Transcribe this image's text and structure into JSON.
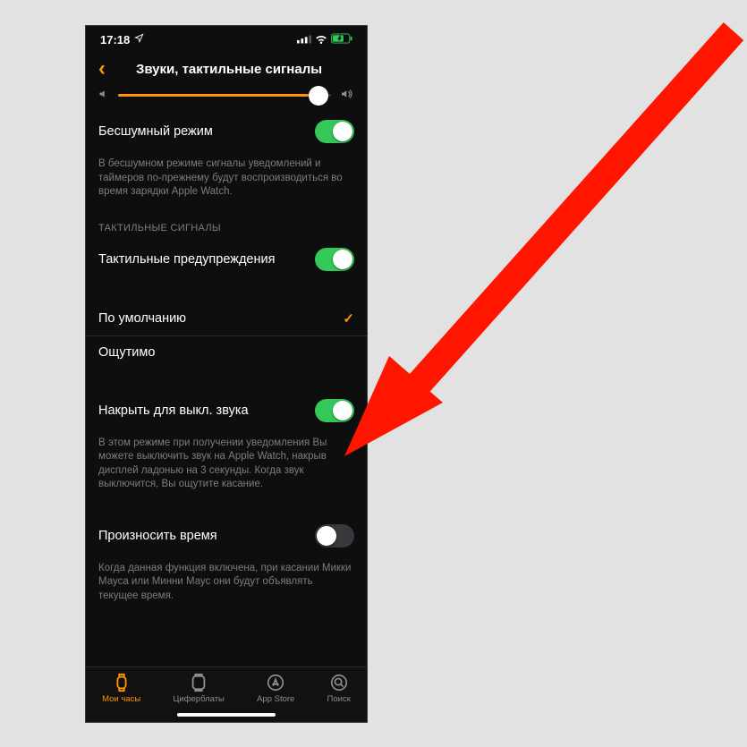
{
  "statusbar": {
    "time": "17:18"
  },
  "nav": {
    "title": "Звуки, тактильные сигналы"
  },
  "silent": {
    "label": "Бесшумный режим",
    "on": true,
    "footer": "В бесшумном режиме сигналы уведомлений и таймеров по-прежнему будут воспроизводиться во время зарядки Apple Watch."
  },
  "haptic": {
    "header": "ТАКТИЛЬНЫЕ СИГНАЛЫ",
    "alerts_label": "Тактильные предупреждения",
    "alerts_on": true,
    "options": {
      "default": "По умолчанию",
      "prominent": "Ощутимо"
    }
  },
  "cover": {
    "label": "Накрыть для выкл. звука",
    "on": true,
    "footer": "В этом режиме при получении уведомления Вы можете выключить звук на Apple Watch, накрыв дисплей ладонью на 3 секунды. Когда звук выключится, Вы ощутите касание."
  },
  "speak_time": {
    "label": "Произносить время",
    "on": false,
    "footer": "Когда данная функция включена, при касании Микки Мауса или Минни Маус они будут объявлять текущее время."
  },
  "tabs": {
    "my_watch": "Мои часы",
    "faces": "Циферблаты",
    "appstore": "App Store",
    "search": "Поиск"
  },
  "colors": {
    "accent": "#ff9500",
    "green": "#34c759"
  }
}
